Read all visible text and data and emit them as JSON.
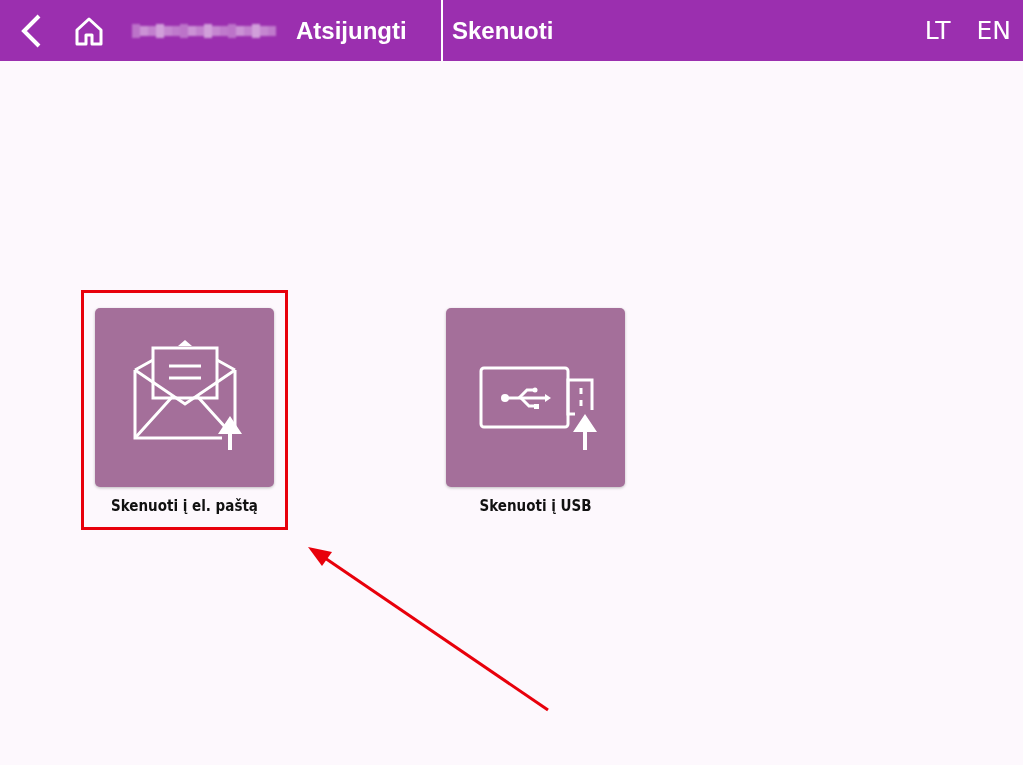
{
  "header": {
    "logout": "Atsijungti",
    "title": "Skenuoti",
    "languages": [
      {
        "label": "LT"
      },
      {
        "label": "EN"
      }
    ]
  },
  "tiles": [
    {
      "kind": "email",
      "label": "Skenuoti į el. paštą",
      "highlighted": true
    },
    {
      "kind": "usb",
      "label": "Skenuoti į USB",
      "highlighted": false
    }
  ]
}
